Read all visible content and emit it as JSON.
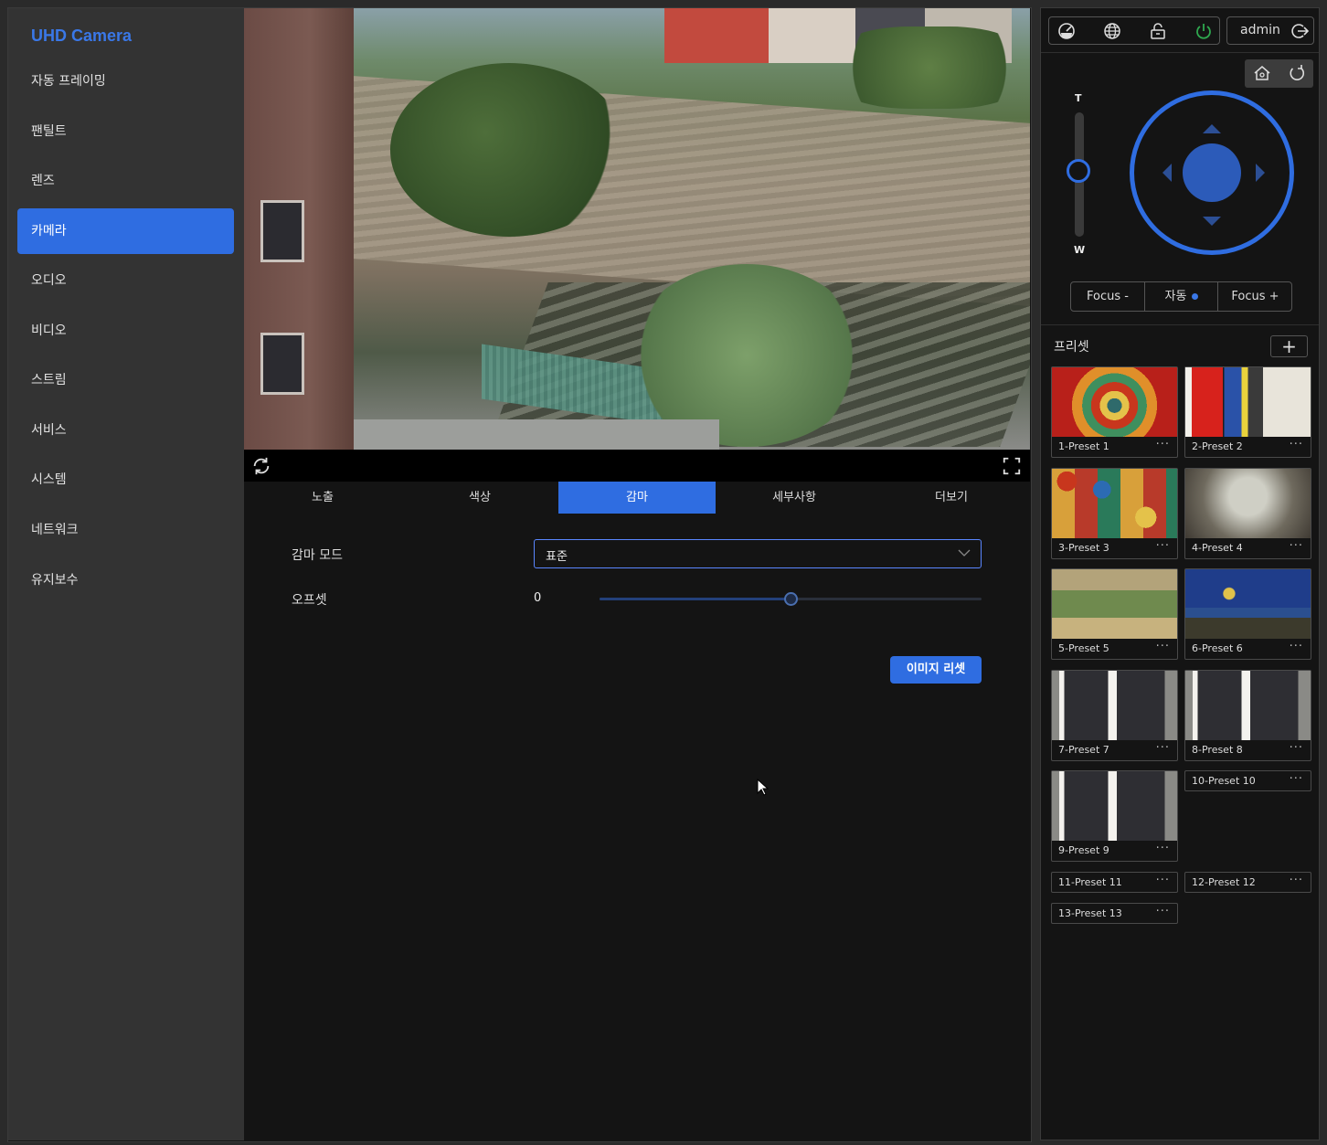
{
  "app": {
    "title": "UHD Camera"
  },
  "sidebar": {
    "items": [
      {
        "label": "자동 프레이밍"
      },
      {
        "label": "팬틸트"
      },
      {
        "label": "렌즈"
      },
      {
        "label": "카메라",
        "active": true
      },
      {
        "label": "오디오"
      },
      {
        "label": "비디오"
      },
      {
        "label": "스트림"
      },
      {
        "label": "서비스"
      },
      {
        "label": "시스템"
      },
      {
        "label": "네트워크"
      },
      {
        "label": "유지보수"
      }
    ]
  },
  "tabs": [
    {
      "label": "노출"
    },
    {
      "label": "색상"
    },
    {
      "label": "감마",
      "active": true
    },
    {
      "label": "세부사항"
    },
    {
      "label": "더보기"
    }
  ],
  "gamma": {
    "mode_label": "감마 모드",
    "mode_value": "표준",
    "offset_label": "오프셋",
    "offset_value": "0",
    "offset_fraction": 0.5,
    "reset_label": "이미지 리셋"
  },
  "header": {
    "user": "admin"
  },
  "ptz": {
    "zoom_top": "T",
    "zoom_bottom": "W",
    "focus_minus": "Focus -",
    "focus_auto": "자동",
    "focus_plus": "Focus +"
  },
  "presets": {
    "title": "프리셋",
    "add_label": "+",
    "more_label": "···",
    "items": [
      {
        "label": "1-Preset 1"
      },
      {
        "label": "2-Preset 2"
      },
      {
        "label": "3-Preset 3"
      },
      {
        "label": "4-Preset 4"
      },
      {
        "label": "5-Preset 5"
      },
      {
        "label": "6-Preset 6"
      },
      {
        "label": "7-Preset 7"
      },
      {
        "label": "8-Preset 8"
      },
      {
        "label": "9-Preset 9"
      },
      {
        "label": "10-Preset 10"
      },
      {
        "label": "11-Preset 11"
      },
      {
        "label": "12-Preset 12"
      },
      {
        "label": "13-Preset 13"
      }
    ]
  },
  "colors": {
    "accent": "#2f6de1",
    "power": "#2fa84f"
  }
}
